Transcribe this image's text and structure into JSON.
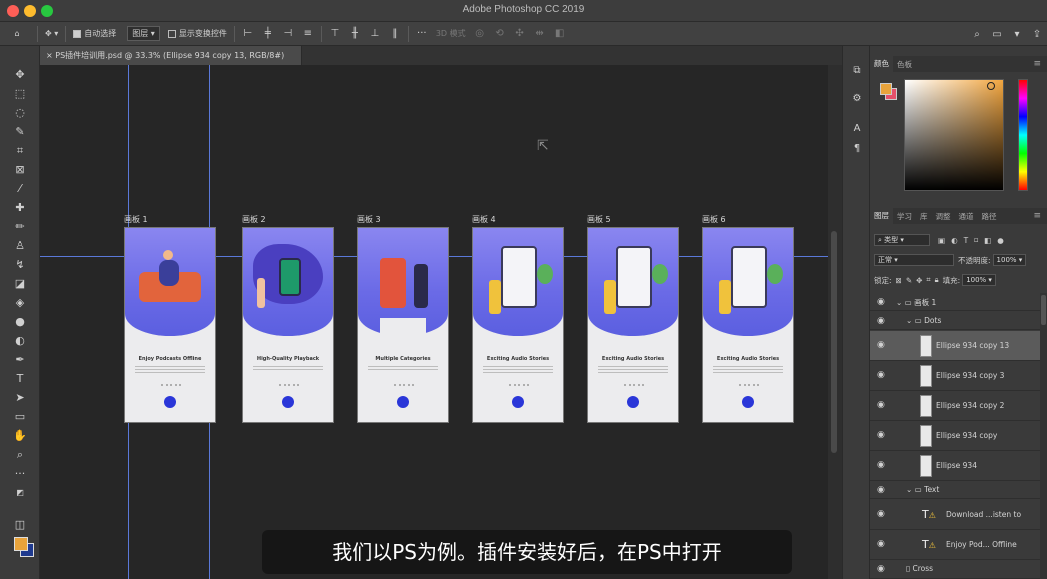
{
  "window": {
    "title": "Adobe Photoshop CC 2019"
  },
  "options_bar": {
    "auto_select_label": "自动选择",
    "auto_select_target": "图层",
    "show_transform_label": "显示变换控件",
    "mode_3d_label": "3D 模式"
  },
  "document": {
    "tab_title": "PS插件培训用.psd @ 33.3% (Ellipse 934 copy 13, RGB/8#)"
  },
  "artboards": [
    {
      "label": "画板 1",
      "title": "Enjoy Podcasts Offline"
    },
    {
      "label": "画板 2",
      "title": "High-Quality Playback"
    },
    {
      "label": "画板 3",
      "title": "Multiple Categories"
    },
    {
      "label": "画板 4",
      "title": "Exciting Audio Stories"
    },
    {
      "label": "画板 5",
      "title": "Exciting Audio Stories"
    },
    {
      "label": "画板 6",
      "title": "Exciting Audio Stories"
    }
  ],
  "subtitle": "我们以PS为例。插件安装好后，在PS中打开",
  "color_panel": {
    "tabs": [
      "颜色",
      "色板"
    ],
    "foreground": "#e8a33b",
    "background": "#e4506a"
  },
  "layers_panel": {
    "tabs": [
      "图层",
      "学习",
      "库",
      "调整",
      "通道",
      "路径"
    ],
    "filter_label": "类型",
    "blend_mode": "正常",
    "opacity_label": "不透明度:",
    "opacity_value": "100%",
    "lock_label": "锁定:",
    "fill_label": "填充:",
    "fill_value": "100%",
    "groups": [
      {
        "name": "画板 1"
      },
      {
        "name": "Dots"
      },
      {
        "name": "Text"
      }
    ],
    "layers": [
      {
        "name": "Ellipse 934 copy 13",
        "selected": true
      },
      {
        "name": "Ellipse 934 copy 3",
        "selected": false
      },
      {
        "name": "Ellipse 934 copy 2",
        "selected": false
      },
      {
        "name": "Ellipse 934 copy",
        "selected": false
      },
      {
        "name": "Ellipse 934",
        "selected": false
      }
    ],
    "text_layers": [
      {
        "name": "Download ...isten to"
      },
      {
        "name": "Enjoy Pod... Offline"
      }
    ],
    "last_layer": "Cross"
  },
  "colors": {
    "accent_blue": "#2a36d8",
    "guide": "#5a78d8",
    "hero_gradient": "#6a6ae6"
  }
}
